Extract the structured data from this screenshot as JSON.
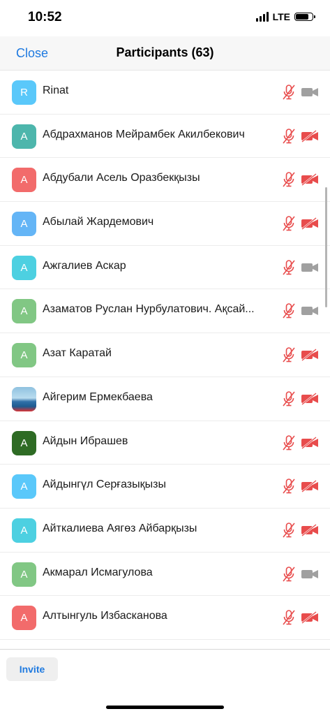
{
  "status_bar": {
    "time": "10:52",
    "network": "LTE",
    "battery_level": 0.85
  },
  "nav": {
    "close_label": "Close",
    "title": "Participants (63)"
  },
  "participants": [
    {
      "initial": "R",
      "name": "Rinat",
      "avatar_color": "#5ac8fa",
      "camera": "gray"
    },
    {
      "initial": "А",
      "name": "Абдрахманов Мейрамбек Акилбекович",
      "avatar_color": "#4db6ac",
      "camera": "red"
    },
    {
      "initial": "А",
      "name": "Абдубали Асель Оразбекқызы",
      "avatar_color": "#f26b6b",
      "camera": "red"
    },
    {
      "initial": "А",
      "name": "Абылай Жардемович",
      "avatar_color": "#64b5f6",
      "camera": "red"
    },
    {
      "initial": "А",
      "name": "Ажгалиев Аскар",
      "avatar_color": "#4dd0e1",
      "camera": "gray"
    },
    {
      "initial": "А",
      "name": "Азаматов Руслан Нурбулатович. Ақсай...",
      "avatar_color": "#81c784",
      "camera": "gray"
    },
    {
      "initial": "А",
      "name": "Азат Каратай",
      "avatar_color": "#81c784",
      "camera": "red"
    },
    {
      "initial": "",
      "name": "Айгерим Ермекбаева",
      "avatar_color": "#6aa9d6",
      "camera": "red",
      "photo": true
    },
    {
      "initial": "А",
      "name": "Айдын Ибрашев",
      "avatar_color": "#2e6b24",
      "camera": "red"
    },
    {
      "initial": "А",
      "name": "Айдынгүл Серғазықызы",
      "avatar_color": "#5ac8fa",
      "camera": "red"
    },
    {
      "initial": "А",
      "name": "Айткалиева Аягөз Айбарқызы",
      "avatar_color": "#4dd0e1",
      "camera": "red"
    },
    {
      "initial": "А",
      "name": "Акмарал Исмагулова",
      "avatar_color": "#81c784",
      "camera": "gray"
    },
    {
      "initial": "А",
      "name": "Алтынгуль Избасканова",
      "avatar_color": "#f26b6b",
      "camera": "red"
    }
  ],
  "footer": {
    "invite_label": "Invite"
  },
  "colors": {
    "accent": "#1f7ae0",
    "muted_red": "#e84c4c",
    "camera_gray": "#a0a0a0"
  }
}
